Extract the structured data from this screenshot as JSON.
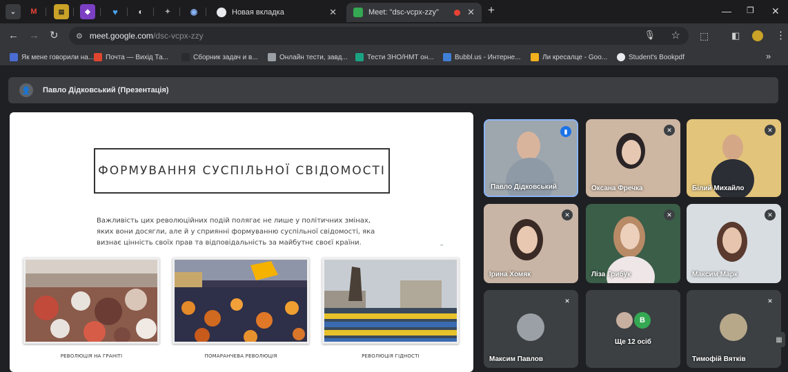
{
  "browser": {
    "tabs": [
      {
        "title": "Новая вкладка",
        "active": false
      },
      {
        "title": "Meet: \"dsc-vcpx-zzy\"",
        "active": true
      }
    ],
    "new_tab_symbol": "+",
    "url_host": "meet.google.com",
    "url_path": "/dsc-vcpx-zzy",
    "bookmarks": [
      "Як мене говорили на...",
      "Почта — Вихід Та...",
      "Сборник задач и в...",
      "Онлайн тести, завд...",
      "Тести ЗНО/НМТ он...",
      "Bubbl.us - Интерне...",
      "Ли кресалце - Goo...",
      "Student's Bookpdf"
    ],
    "bookmarks_overflow": "»"
  },
  "meet": {
    "presenter_label": "Павло Дідковський (Презентація)",
    "slide": {
      "title": "ФОРМУВАННЯ СУСПІЛЬНОЇ СВІДОМОСТІ",
      "body": "Важливість цих революційних подій полягає не лише у політичних змінах, яких вони досягли, але й у сприянні формуванню суспільної свідомості, яка визнає цінність своїх прав та відповідальність за майбутнє своєї країни.",
      "captions": [
        "РЕВОЛЮЦІЯ НА ГРАНІТІ",
        "ПОМАРАНЧЕВА РЕВОЛЮЦІЯ",
        "РЕВОЛЮЦІЯ ГІДНОСТІ"
      ]
    },
    "participants": [
      {
        "name": "Павло Дідковський",
        "speaking": true
      },
      {
        "name": "Оксана Фречка",
        "muted": true
      },
      {
        "name": "Білий Михайло",
        "muted": true
      },
      {
        "name": "Ірина Хомяк",
        "muted": true
      },
      {
        "name": "Ліза Грибук",
        "muted": true
      },
      {
        "name": "Максим Марк",
        "muted": true
      },
      {
        "name": "Максим Павлов",
        "muted": true
      },
      {
        "name": "Ще 12 осіб",
        "avatar_letter": "B"
      },
      {
        "name": "Тимофій Вятків",
        "muted": true
      }
    ]
  },
  "colors": {
    "accent": "#8ab4f8",
    "speaking_badge": "#1a73e8",
    "tab_bg": "#35363a"
  }
}
